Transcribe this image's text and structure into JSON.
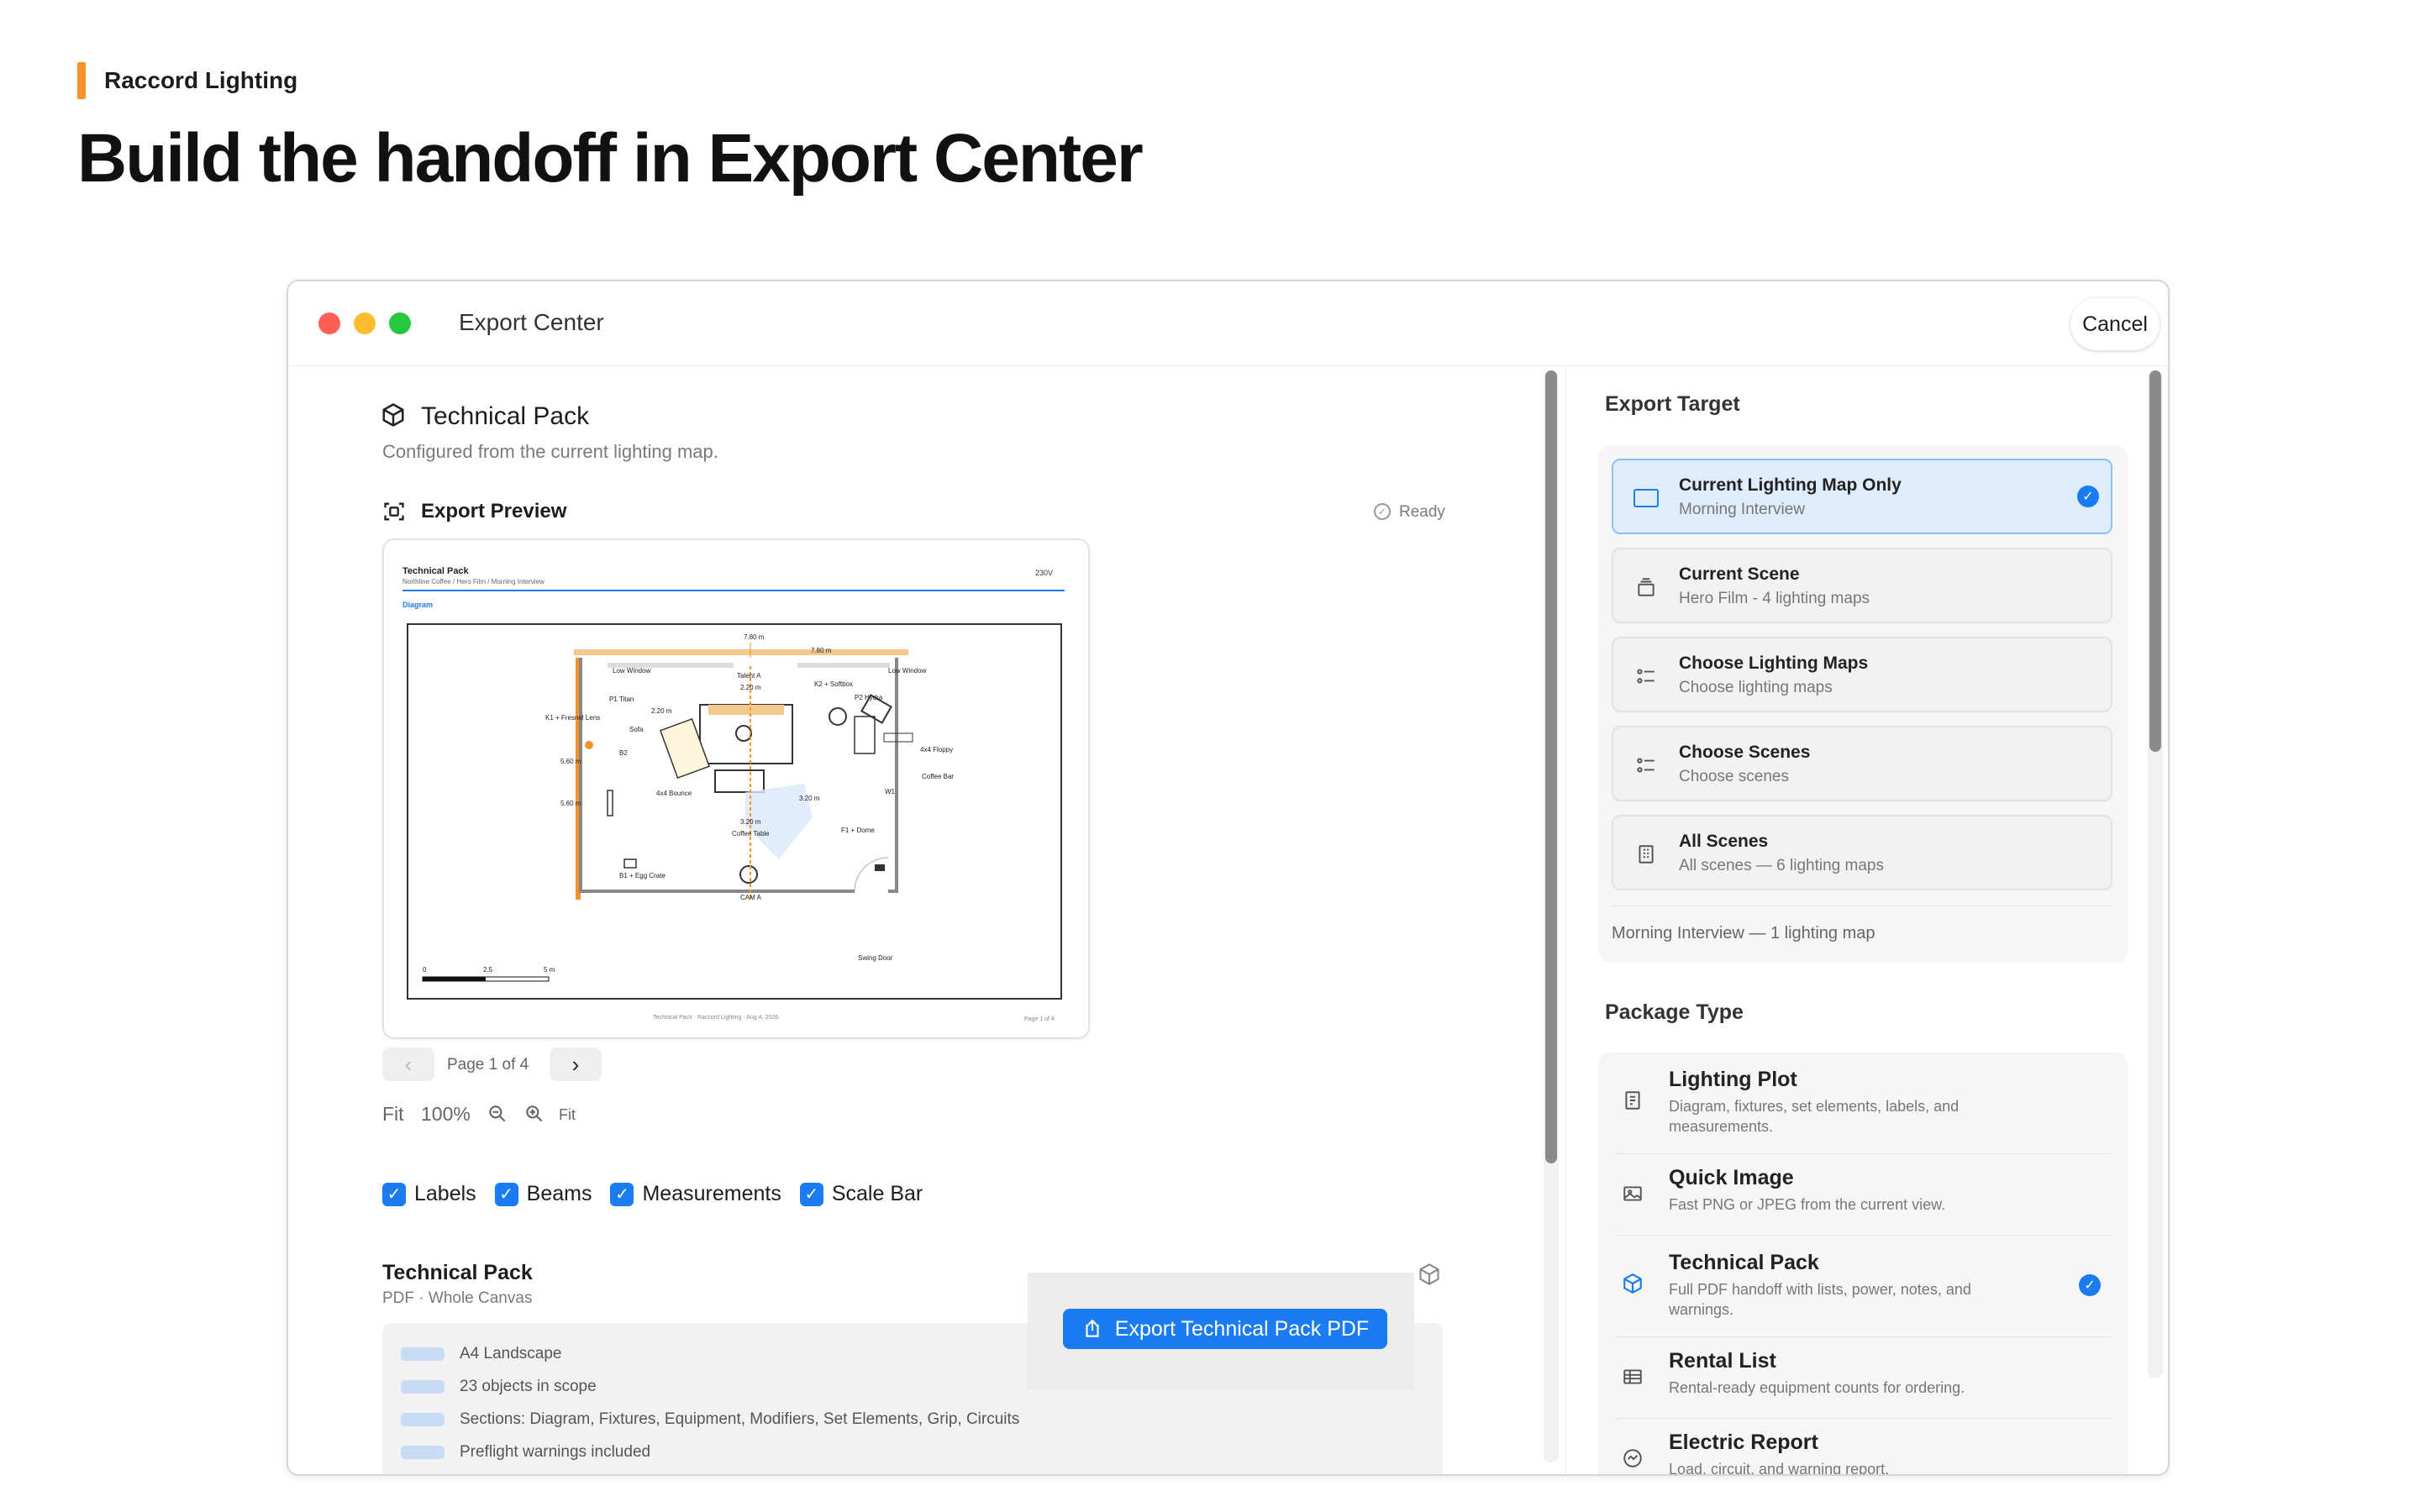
{
  "brand": {
    "name": "Raccord Lighting"
  },
  "hero_title": "Build the handoff in Export Center",
  "window": {
    "title": "Export Center",
    "cancel_label": "Cancel"
  },
  "left": {
    "pack_title": "Technical Pack",
    "pack_subtitle": "Configured from the current lighting map.",
    "preview_title": "Export Preview",
    "preview_status": "Ready",
    "pager": {
      "label": "Page 1 of 4",
      "prev": "‹",
      "next": "›"
    },
    "zoom": {
      "fit_label": "Fit",
      "zoom_level": "100%",
      "fit_small": "Fit"
    },
    "toggles": [
      {
        "label": "Labels",
        "checked": true
      },
      {
        "label": "Beams",
        "checked": true
      },
      {
        "label": "Measurements",
        "checked": true
      },
      {
        "label": "Scale Bar",
        "checked": true
      }
    ],
    "summary": {
      "title": "Technical Pack",
      "subtitle": "PDF · Whole Canvas",
      "rows": [
        "A4 Landscape",
        "23 objects in scope",
        "Sections: Diagram, Fixtures, Equipment, Modifiers, Set Elements, Grip, Circuits",
        "Preflight warnings included"
      ]
    },
    "export_button": "Export Technical Pack PDF"
  },
  "preview_doc": {
    "title": "Technical Pack",
    "subtitle": "Northline Coffee / Hero Film / Morning Interview",
    "voltage": "230V",
    "section": "Diagram",
    "labels": {
      "dim_top_center": "7.80 m",
      "dim_top_right": "7.80 m",
      "low_window_left": "Low Window",
      "low_window_right": "Low Window",
      "talent": "Talent A",
      "dim_talent": "2.20 m",
      "k2": "K2 + Softbox",
      "p1": "P1 Titan",
      "p2": "P2 Hydra",
      "k1": "K1 + Fresnel Lens",
      "dim_p1": "2.20 m",
      "sofa": "Sofa",
      "floppy": "4x4 Floppy",
      "coffee_bar": "Coffee Bar",
      "dim_left_a": "5.60 m",
      "dim_left_b": "5.60 m",
      "b2": "B2",
      "bounce": "4x4 Bounce",
      "dim_mid": "3.20 m",
      "w1": "W1",
      "dim_table": "3.20 m",
      "coffee_table": "Coffee Table",
      "f1": "F1 + Dome",
      "b1": "B1 + Egg Crate",
      "cam": "CAM A",
      "swing_door": "Swing Door",
      "scale_0": "0",
      "scale_mid": "2.5",
      "scale_end": "5 m"
    },
    "footer": "Technical Pack · Raccord Lighting · Aug 4, 2026",
    "page_footer": "Page 1 of 4"
  },
  "right": {
    "target_title": "Export Target",
    "targets": [
      {
        "title": "Current Lighting Map Only",
        "subtitle": "Morning Interview",
        "icon": "rectangle-icon",
        "selected": true
      },
      {
        "title": "Current Scene",
        "subtitle": "Hero Film - 4 lighting maps",
        "icon": "stack-icon",
        "selected": false
      },
      {
        "title": "Choose Lighting Maps",
        "subtitle": "Choose lighting maps",
        "icon": "checklist-icon",
        "selected": false
      },
      {
        "title": "Choose Scenes",
        "subtitle": "Choose scenes",
        "icon": "checklist-icon",
        "selected": false
      },
      {
        "title": "All Scenes",
        "subtitle": "All scenes — 6 lighting maps",
        "icon": "building-icon",
        "selected": false
      }
    ],
    "target_summary": "Morning Interview — 1 lighting map",
    "package_title": "Package Type",
    "packages": [
      {
        "title": "Lighting Plot",
        "subtitle": "Diagram, fixtures, set elements, labels, and measurements.",
        "icon": "plot-icon",
        "selected": false
      },
      {
        "title": "Quick Image",
        "subtitle": "Fast PNG or JPEG from the current view.",
        "icon": "image-icon",
        "selected": false
      },
      {
        "title": "Technical Pack",
        "subtitle": "Full PDF handoff with lists, power, notes, and warnings.",
        "icon": "cube-icon",
        "selected": true
      },
      {
        "title": "Rental List",
        "subtitle": "Rental-ready equipment counts for ordering.",
        "icon": "table-icon",
        "selected": false
      },
      {
        "title": "Electric Report",
        "subtitle": "Load, circuit, and warning report.",
        "icon": "gauge-icon",
        "selected": false
      }
    ]
  },
  "colors": {
    "accent": "#1b7cf2",
    "brand": "#f7922b",
    "selected_bg": "#deecfb"
  }
}
